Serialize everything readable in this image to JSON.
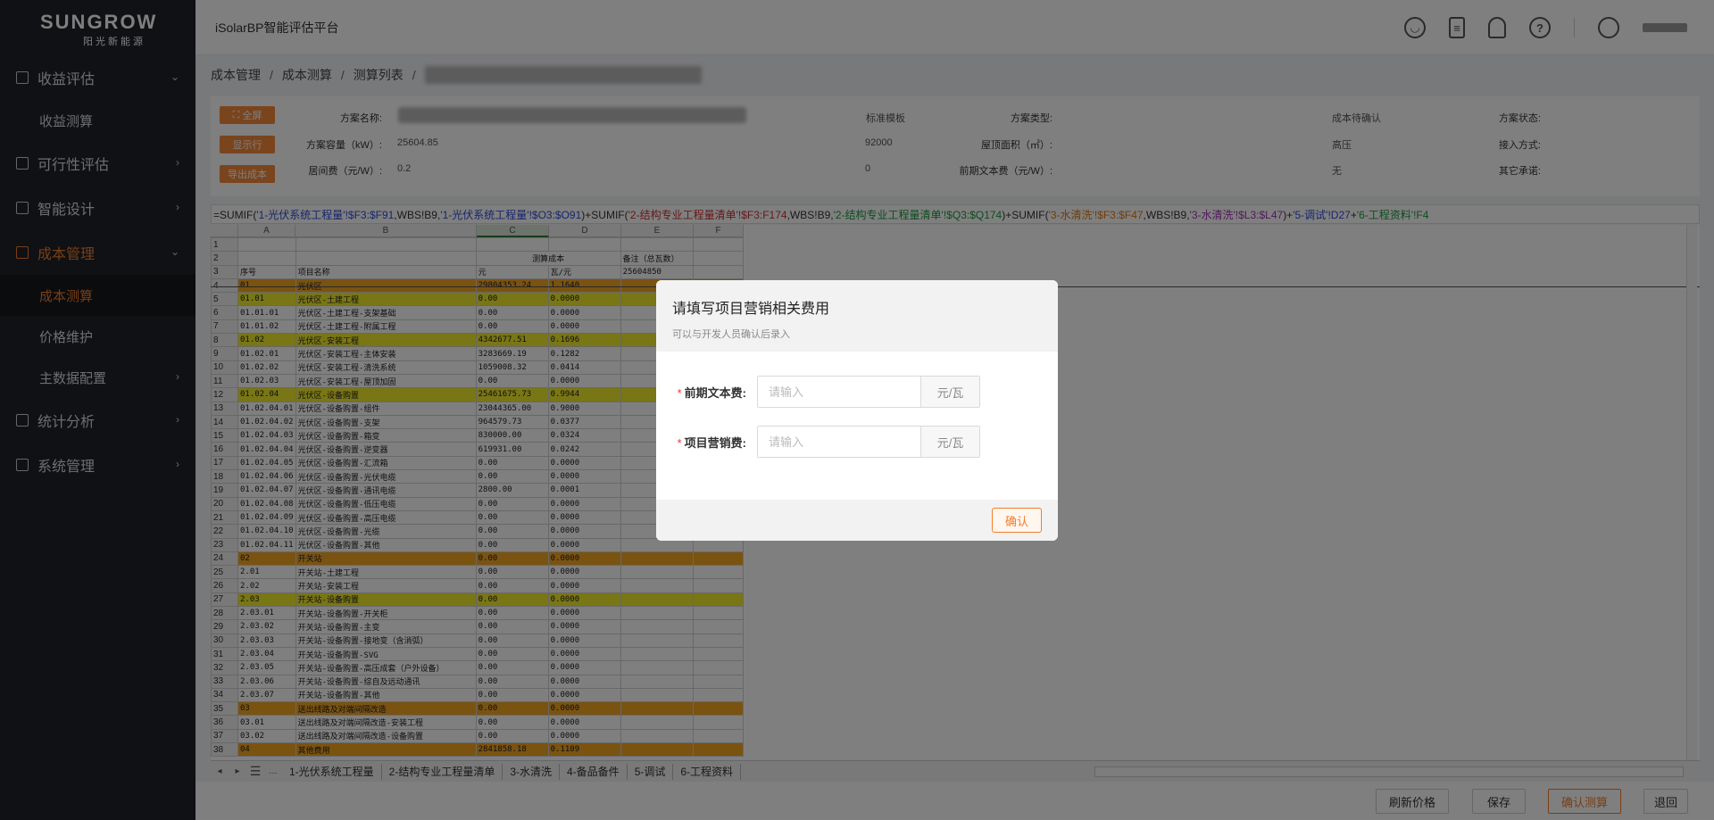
{
  "brand": {
    "name": "SUNGROW",
    "sub": "阳光新能源"
  },
  "header": {
    "app_title": "iSolarBP智能评估平台"
  },
  "sidebar": {
    "items": [
      {
        "label": "收益评估",
        "icon": "analysis-icon",
        "arrow": "⌄"
      },
      {
        "label": "收益测算"
      },
      {
        "label": "可行性评估",
        "icon": "chart-icon",
        "arrow": "›"
      },
      {
        "label": "智能设计",
        "icon": "design-icon",
        "arrow": "›"
      },
      {
        "label": "成本管理",
        "icon": "cost-icon",
        "arrow": "⌄"
      },
      {
        "label": "成本测算"
      },
      {
        "label": "价格维护"
      },
      {
        "label": "主数据配置",
        "arrow": "›"
      },
      {
        "label": "统计分析",
        "icon": "stats-icon",
        "arrow": "›"
      },
      {
        "label": "系统管理",
        "icon": "system-icon",
        "arrow": "›"
      }
    ]
  },
  "breadcrumb": [
    "成本管理",
    "成本测算",
    "测算列表"
  ],
  "info": {
    "buttons": [
      "全屏",
      "显示行",
      "导出成本"
    ],
    "fields": {
      "scheme_name_label": "方案名称:",
      "scheme_type_label": "方案类型:",
      "scheme_type_value": "标准模板",
      "scheme_status_label": "方案状态:",
      "scheme_status_value": "成本待确认",
      "capacity_label": "方案容量（kW）:",
      "capacity_value": "25604.85",
      "roof_area_label": "屋顶面积（㎡）:",
      "roof_area_value": "92000",
      "access_label": "接入方式:",
      "access_value": "高压",
      "broker_label": "居间费（元/W）:",
      "broker_value": "0.2",
      "early_cost_label": "前期文本费（元/W）:",
      "early_cost_value": "0",
      "other_label": "其它承诺:",
      "other_value": "无"
    }
  },
  "formula": {
    "parts": [
      {
        "t": "=SUMIF(",
        "c": ""
      },
      {
        "t": "'1-光伏系统工程量'!$F3:$F91",
        "c": "f-blue"
      },
      {
        "t": ",WBS!B9,",
        "c": ""
      },
      {
        "t": "'1-光伏系统工程量'!$O3:$O91",
        "c": "f-blue"
      },
      {
        "t": ")+SUMIF(",
        "c": ""
      },
      {
        "t": "'2-结构专业工程量清单'!$F3:F174",
        "c": "f-red"
      },
      {
        "t": ",WBS!B9,",
        "c": ""
      },
      {
        "t": "'2-结构专业工程量清单'!$Q3:$Q174",
        "c": "f-green"
      },
      {
        "t": ")+SUMIF(",
        "c": ""
      },
      {
        "t": "'3-水清洗'!$F3:$F47",
        "c": "f-orange"
      },
      {
        "t": ",WBS!B9,",
        "c": ""
      },
      {
        "t": "'3-水清洗'!$L3:$L47",
        "c": "f-purple"
      },
      {
        "t": ")+",
        "c": ""
      },
      {
        "t": "'5-调试'!D27",
        "c": "f-blue"
      },
      {
        "t": "+",
        "c": ""
      },
      {
        "t": "'6-工程资料'!F4",
        "c": "f-green"
      }
    ]
  },
  "sheet": {
    "columns": [
      "A",
      "B",
      "C",
      "D",
      "E",
      "F"
    ],
    "header2": {
      "c": "测算成本",
      "e": "备注（总瓦数）"
    },
    "header3": {
      "a": "序号",
      "b": "项目名称",
      "c": "元",
      "d": "瓦/元",
      "e": "25604850"
    },
    "rows": [
      {
        "n": "4",
        "a": "01",
        "b": "光伏区",
        "c": "29804353.24",
        "d": "1.1640",
        "s": "orange"
      },
      {
        "n": "5",
        "a": "01.01",
        "b": "光伏区-土建工程",
        "c": "0.00",
        "d": "0.0000",
        "s": "yellow"
      },
      {
        "n": "6",
        "a": "01.01.01",
        "b": "光伏区-土建工程-支架基础",
        "c": "0.00",
        "d": "0.0000",
        "s": ""
      },
      {
        "n": "7",
        "a": "01.01.02",
        "b": "光伏区-土建工程-附属工程",
        "c": "0.00",
        "d": "0.0000",
        "s": ""
      },
      {
        "n": "8",
        "a": "01.02",
        "b": "光伏区-安装工程",
        "c": "4342677.51",
        "d": "0.1696",
        "s": "yellow"
      },
      {
        "n": "9",
        "a": "01.02.01",
        "b": "光伏区-安装工程-主体安装",
        "c": "3283669.19",
        "d": "0.1282",
        "s": ""
      },
      {
        "n": "10",
        "a": "01.02.02",
        "b": "光伏区-安装工程-清洗系统",
        "c": "1059008.32",
        "d": "0.0414",
        "s": ""
      },
      {
        "n": "11",
        "a": "01.02.03",
        "b": "光伏区-安装工程-屋顶加固",
        "c": "0.00",
        "d": "0.0000",
        "s": ""
      },
      {
        "n": "12",
        "a": "01.02.04",
        "b": "光伏区-设备购置",
        "c": "25461675.73",
        "d": "0.9944",
        "s": "yellow"
      },
      {
        "n": "13",
        "a": "01.02.04.01",
        "b": "光伏区-设备购置-组件",
        "c": "23044365.00",
        "d": "0.9000",
        "s": ""
      },
      {
        "n": "14",
        "a": "01.02.04.02",
        "b": "光伏区-设备购置-支架",
        "c": "964579.73",
        "d": "0.0377",
        "s": ""
      },
      {
        "n": "15",
        "a": "01.02.04.03",
        "b": "光伏区-设备购置-箱变",
        "c": "830000.00",
        "d": "0.0324",
        "s": ""
      },
      {
        "n": "16",
        "a": "01.02.04.04",
        "b": "光伏区-设备购置-逆变器",
        "c": "619931.00",
        "d": "0.0242",
        "s": ""
      },
      {
        "n": "17",
        "a": "01.02.04.05",
        "b": "光伏区-设备购置-汇流箱",
        "c": "0.00",
        "d": "0.0000",
        "s": ""
      },
      {
        "n": "18",
        "a": "01.02.04.06",
        "b": "光伏区-设备购置-光伏电缆",
        "c": "0.00",
        "d": "0.0000",
        "s": ""
      },
      {
        "n": "19",
        "a": "01.02.04.07",
        "b": "光伏区-设备购置-通讯电缆",
        "c": "2800.00",
        "d": "0.0001",
        "s": ""
      },
      {
        "n": "20",
        "a": "01.02.04.08",
        "b": "光伏区-设备购置-低压电缆",
        "c": "0.00",
        "d": "0.0000",
        "s": ""
      },
      {
        "n": "21",
        "a": "01.02.04.09",
        "b": "光伏区-设备购置-高压电缆",
        "c": "0.00",
        "d": "0.0000",
        "s": ""
      },
      {
        "n": "22",
        "a": "01.02.04.10",
        "b": "光伏区-设备购置-光缆",
        "c": "0.00",
        "d": "0.0000",
        "s": ""
      },
      {
        "n": "23",
        "a": "01.02.04.11",
        "b": "光伏区-设备购置-其他",
        "c": "0.00",
        "d": "0.0000",
        "s": ""
      },
      {
        "n": "24",
        "a": "02",
        "b": "开关站",
        "c": "0.00",
        "d": "0.0000",
        "s": "orange"
      },
      {
        "n": "25",
        "a": "2.01",
        "b": "开关站-土建工程",
        "c": "0.00",
        "d": "0.0000",
        "s": ""
      },
      {
        "n": "26",
        "a": "2.02",
        "b": "开关站-安装工程",
        "c": "0.00",
        "d": "0.0000",
        "s": ""
      },
      {
        "n": "27",
        "a": "2.03",
        "b": "开关站-设备购置",
        "c": "0.00",
        "d": "0.0000",
        "s": "yellow"
      },
      {
        "n": "28",
        "a": "2.03.01",
        "b": "开关站-设备购置-开关柜",
        "c": "0.00",
        "d": "0.0000",
        "s": ""
      },
      {
        "n": "29",
        "a": "2.03.02",
        "b": "开关站-设备购置-主变",
        "c": "0.00",
        "d": "0.0000",
        "s": ""
      },
      {
        "n": "30",
        "a": "2.03.03",
        "b": "开关站-设备购置-接地变（含消弧）",
        "c": "0.00",
        "d": "0.0000",
        "s": ""
      },
      {
        "n": "31",
        "a": "2.03.04",
        "b": "开关站-设备购置-SVG",
        "c": "0.00",
        "d": "0.0000",
        "s": ""
      },
      {
        "n": "32",
        "a": "2.03.05",
        "b": "开关站-设备购置-高压成套（户外设备）",
        "c": "0.00",
        "d": "0.0000",
        "s": ""
      },
      {
        "n": "33",
        "a": "2.03.06",
        "b": "开关站-设备购置-综自及远动通讯",
        "c": "0.00",
        "d": "0.0000",
        "s": ""
      },
      {
        "n": "34",
        "a": "2.03.07",
        "b": "开关站-设备购置-其他",
        "c": "0.00",
        "d": "0.0000",
        "s": ""
      },
      {
        "n": "35",
        "a": "03",
        "b": "送出线路及对端间隔改造",
        "c": "0.00",
        "d": "0.0000",
        "s": "orange"
      },
      {
        "n": "36",
        "a": "03.01",
        "b": "送出线路及对端间隔改造-安装工程",
        "c": "0.00",
        "d": "0.0000",
        "s": ""
      },
      {
        "n": "37",
        "a": "03.02",
        "b": "送出线路及对端间隔改造-设备购置",
        "c": "0.00",
        "d": "0.0000",
        "s": ""
      },
      {
        "n": "38",
        "a": "04",
        "b": "其他费用",
        "c": "2841858.18",
        "d": "0.1109",
        "s": "orange"
      }
    ]
  },
  "sheet_tabs": [
    "1-光伏系统工程量",
    "2-结构专业工程量清单",
    "3-水清洗",
    "4-备品备件",
    "5-调试",
    "6-工程资料"
  ],
  "bottom_buttons": {
    "refresh": "刷新价格",
    "save": "保存",
    "confirm": "确认测算",
    "back": "退回"
  },
  "modal": {
    "title": "请填写项目营销相关费用",
    "subtitle": "可以与开发人员确认后录入",
    "field1_label": "前期文本费:",
    "field1_placeholder": "请输入",
    "field2_label": "项目营销费:",
    "field2_placeholder": "请输入",
    "unit": "元/瓦",
    "confirm": "确认"
  },
  "colors": {
    "accent": "#f57c2a",
    "sidebar": "#1f2329",
    "row_orange": "#f5a623",
    "row_yellow": "#f2ed2b"
  }
}
